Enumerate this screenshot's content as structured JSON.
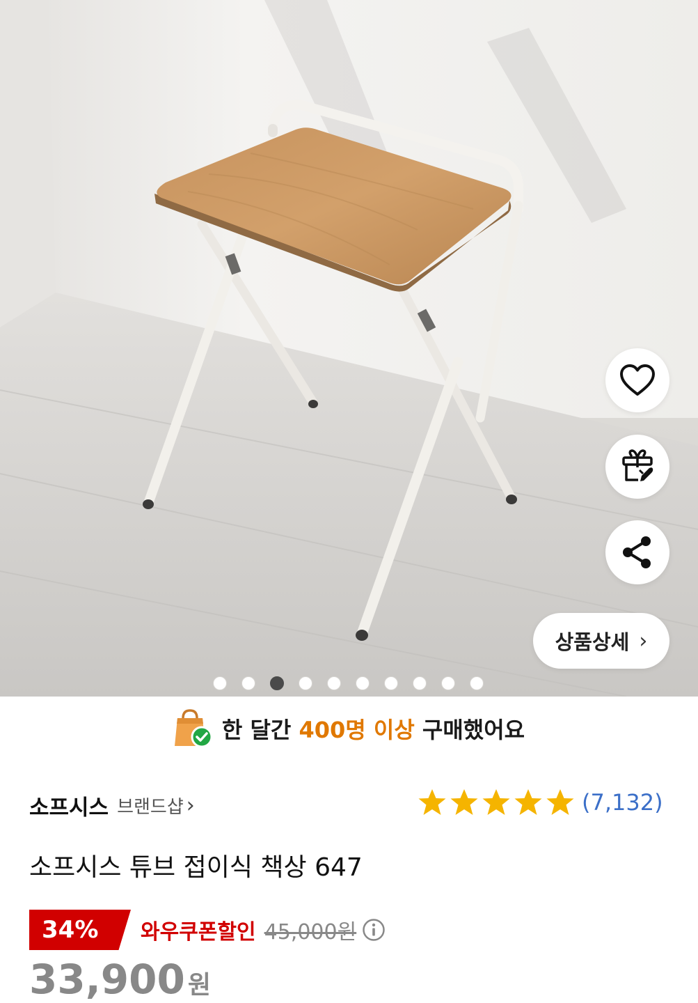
{
  "gallery": {
    "image_alt": "소프시스 튜브 접이식 책상 647",
    "dot_count": 10,
    "active_index": 2,
    "detail_button_label": "상품상세",
    "detail_button_chevron": "›",
    "actions": [
      {
        "name": "wishlist",
        "icon": "heart-icon"
      },
      {
        "name": "gift",
        "icon": "gift-icon"
      },
      {
        "name": "share",
        "icon": "share-icon"
      }
    ]
  },
  "purchase_banner": {
    "icon": "shopping-bag-check-icon",
    "prefix": "한 달간",
    "highlight": "400명 이상",
    "suffix": "구매했어요",
    "highlight_color": "#e07800"
  },
  "brand": {
    "name": "소프시스",
    "shop_link": "브랜드샵",
    "shop_chevron": "›"
  },
  "rating": {
    "stars": 5,
    "review_count": "(7,132)",
    "star_color": "#f5b400"
  },
  "product": {
    "title": "소프시스 튜브 접이식 책상 647"
  },
  "price": {
    "discount": "34%",
    "coupon_label": "와우쿠폰할인",
    "original": "45,000원",
    "sale_value": "33,900",
    "sale_unit": "원",
    "accent_color": "#d10000"
  }
}
